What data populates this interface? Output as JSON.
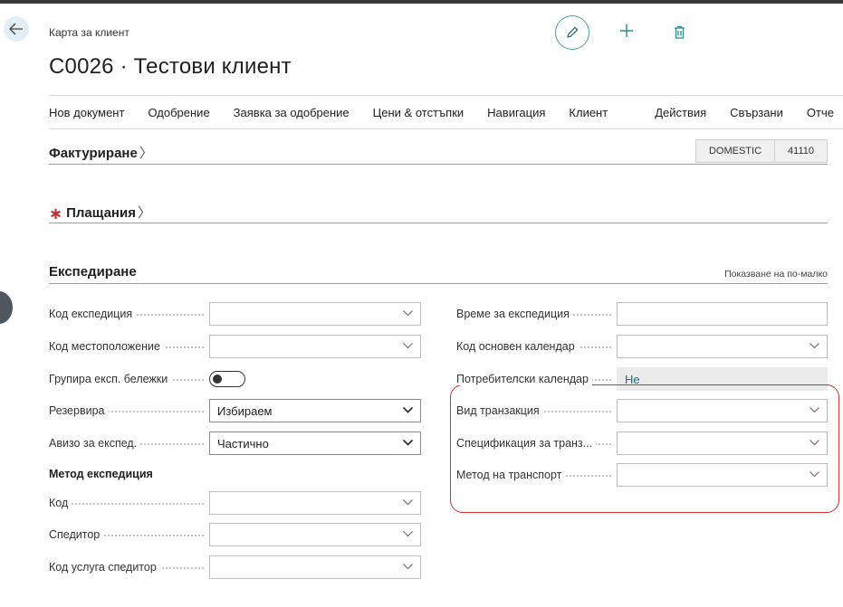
{
  "header": {
    "breadcrumb": "Карта за клиент",
    "title": "C0026 · Тестови клиент"
  },
  "actions": {
    "items": [
      "Нов документ",
      "Одобрение",
      "Заявка за одобрение",
      "Цени & отстъпки",
      "Навигация",
      "Клиент"
    ],
    "items_after_sep": [
      "Действия",
      "Свързани",
      "Отче"
    ]
  },
  "sections": {
    "invoicing": {
      "title": "Фактуриране",
      "tags": [
        "DOMESTIC",
        "41110"
      ]
    },
    "payments": {
      "title": "Плащания",
      "required_mark": "∗"
    },
    "shipping": {
      "title": "Експедиране",
      "show_less": "Показване на по-малко"
    }
  },
  "shipping_left": {
    "fields": [
      {
        "label": "Код експедиция",
        "value": ""
      },
      {
        "label": "Код местоположение",
        "value": ""
      },
      {
        "label": "Групира експ. бележки",
        "value": "off"
      },
      {
        "label": "Резервира",
        "value": "Избираем"
      },
      {
        "label": "Авизо за експед.",
        "value": "Частично"
      }
    ],
    "method_group": "Метод експедиция",
    "method_fields": [
      {
        "label": "Код",
        "value": ""
      },
      {
        "label": "Спедитор",
        "value": ""
      },
      {
        "label": "Код услуга спедитор",
        "value": ""
      }
    ]
  },
  "shipping_right": {
    "fields": [
      {
        "label": "Време за експедиция",
        "value": ""
      },
      {
        "label": "Код основен календар",
        "value": ""
      },
      {
        "label": "Потребителски календар",
        "value": "Не"
      },
      {
        "label": "Вид транзакция",
        "value": ""
      },
      {
        "label": "Спецификация за транз...",
        "value": ""
      },
      {
        "label": "Метод на транспорт",
        "value": ""
      }
    ]
  },
  "colors": {
    "accent": "#4aa3a3",
    "highlight": "#d32f2f",
    "link": "#0e7a8a"
  },
  "icons": [
    "back-arrow-icon",
    "pencil-icon",
    "plus-icon",
    "trash-icon",
    "chevron-down-icon"
  ]
}
